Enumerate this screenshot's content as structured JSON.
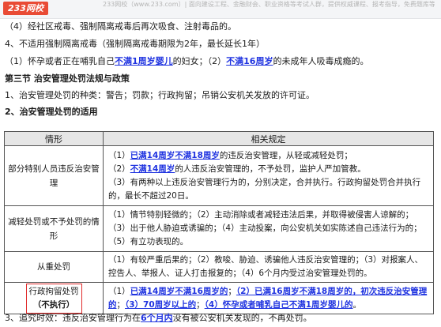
{
  "banner": {
    "logo": "233网校",
    "text": "233网校（www.233.com）| 面向建设工程、金融财会、职业资格等考试人群，提供权威课程、报考指导，免费题库等考试培训服务。"
  },
  "lines": {
    "l1": "（4）经社区戒毒、强制隔离戒毒后再次吸食、注射毒品的。",
    "l2": "4、不适用强制隔离戒毒（强制隔离戒毒期限为2年，最长延长1年）",
    "l3_a": "（1）怀孕或者正在哺乳自己",
    "l3_b": "不满1周岁婴儿",
    "l3_c": "的妇女；（2）",
    "l3_d": "不满16周岁",
    "l3_e": "的未成年人吸毒成瘾的。",
    "l4": "第三节  治安管理处罚法规与政策",
    "l5": "1、治安管理处罚的种类：警告；罚款；行政拘留；吊销公安机关发放的许可证。",
    "l6": "2、治安管理处罚的适用"
  },
  "table": {
    "header": {
      "col1": "情形",
      "col2": "相关规定"
    },
    "row1": {
      "left": "部分特别人员违反治安管理",
      "i1_a": "（1）",
      "i1_b": "已满14周岁不满18周岁",
      "i1_c": "的违反治安管理，从轻或减轻处罚；",
      "i2_a": "（2）",
      "i2_b": "不满14周岁",
      "i2_c": "的人违反治安管理的，不予处罚，监护人严加管教。",
      "i3": "（3）有两种以上违反治安管理行为的，分别决定，合并执行。行政拘留处罚合并执行的，最长不超过20日。"
    },
    "row2": {
      "left": "减轻处罚或不予处罚的情形",
      "i1": "（1）情节特别轻微的；（2）主动消除或者减轻违法后果，并取得被侵害人谅解的；",
      "i2": "（3）出于他人胁迫或诱骗的；（4）主动投案，向公安机关如实陈述自己违法行为的；",
      "i3": "（5）有立功表现的。"
    },
    "row3": {
      "left": "从重处罚",
      "i1": "（1）有较严重后果的；（2）教唆、胁迫、诱骗他人违反治安管理的；（3）对报案人、控告人、举报人、证人打击报复的；（4）6个月内受过治安管理处罚的。"
    },
    "row4": {
      "left_1": "行政拘留处罚",
      "left_2": "（不执行）",
      "p1": "（1）",
      "h1": "已满14周岁不满16周岁的",
      "s1": "；",
      "h2": "（2）已满16周岁不满18周岁的，初次违反治安管理的",
      "s2": "；",
      "h3": "（3）70周岁以上的",
      "s3": "；",
      "h4": "（4）怀孕或者哺乳自己不满1周岁婴儿的",
      "s4": "。"
    }
  },
  "footer": {
    "a": "3、追究时效：违反治安管理行为在",
    "b": "6个月内",
    "c": "没有被公安机关发现的，不再处罚。"
  },
  "colors": {
    "highlight": "#1f33e0",
    "box": "#e02b2b",
    "brand": "#e94b35"
  }
}
